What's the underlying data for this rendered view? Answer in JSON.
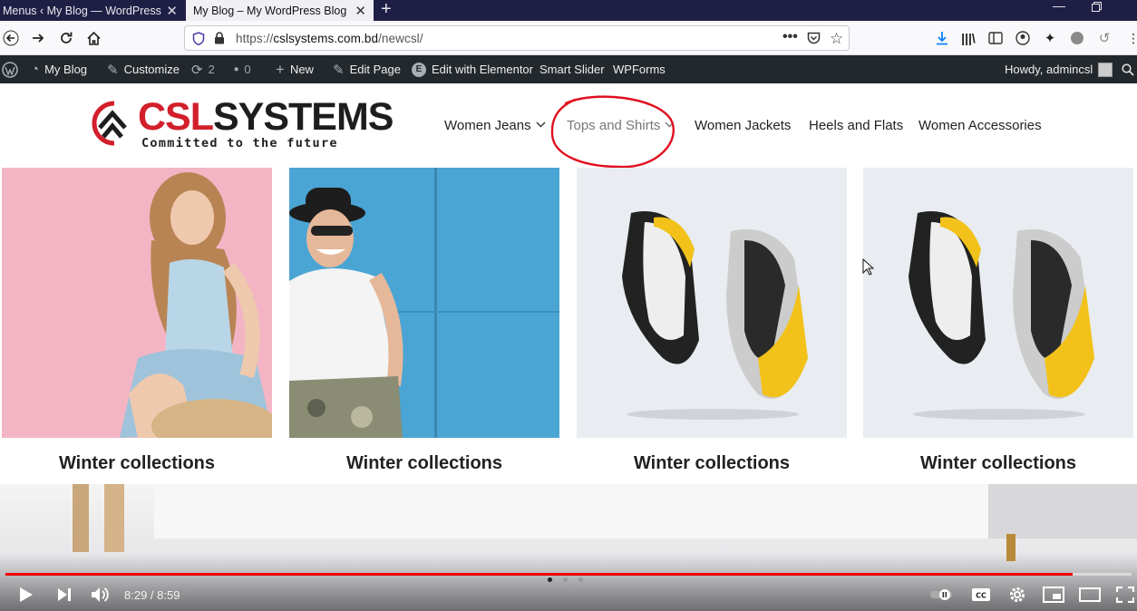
{
  "browser": {
    "tabs": [
      {
        "title": "Menus ‹ My Blog — WordPress",
        "active": false
      },
      {
        "title": "My Blog – My WordPress Blog",
        "active": true
      }
    ],
    "url": {
      "scheme": "https://",
      "host": "cslsystems.com.bd",
      "path": "/newcsl/"
    }
  },
  "wp_admin_bar": {
    "site_name": "My Blog",
    "customize": "Customize",
    "updates_count": "2",
    "comments_count": "0",
    "new_label": "New",
    "edit_page": "Edit Page",
    "edit_elementor": "Edit with Elementor",
    "smart_slider": "Smart Slider",
    "wpforms": "WPForms",
    "howdy": "Howdy, admincsl"
  },
  "site": {
    "logo_title_red": "CSL",
    "logo_title_dark": "SYSTEMS",
    "logo_tagline": "Committed to the future",
    "menu": [
      {
        "label": "Women Jeans",
        "has_dropdown": true
      },
      {
        "label": "Tops and Shirts",
        "has_dropdown": true
      },
      {
        "label": "Women Jackets",
        "has_dropdown": false
      },
      {
        "label": "Heels and Flats",
        "has_dropdown": false
      },
      {
        "label": "Women Accessories",
        "has_dropdown": false
      }
    ],
    "tiles": [
      {
        "caption": "Winter collections",
        "image": "woman-pink-background"
      },
      {
        "caption": "Winter collections",
        "image": "man-hat-blue-wall"
      },
      {
        "caption": "Winter collections",
        "image": "yellow-sneakers"
      },
      {
        "caption": "Winter collections",
        "image": "yellow-sneakers"
      }
    ]
  },
  "video_player": {
    "time_current": "8:29",
    "time_total": "8:59",
    "time_display": "8:29 / 8:59",
    "progress_fraction": 0.948
  },
  "colors": {
    "brand_red": "#d21f2b",
    "wp_bar": "#23282d",
    "tab_strip": "#1f1f46",
    "progress_red": "#e00000"
  }
}
